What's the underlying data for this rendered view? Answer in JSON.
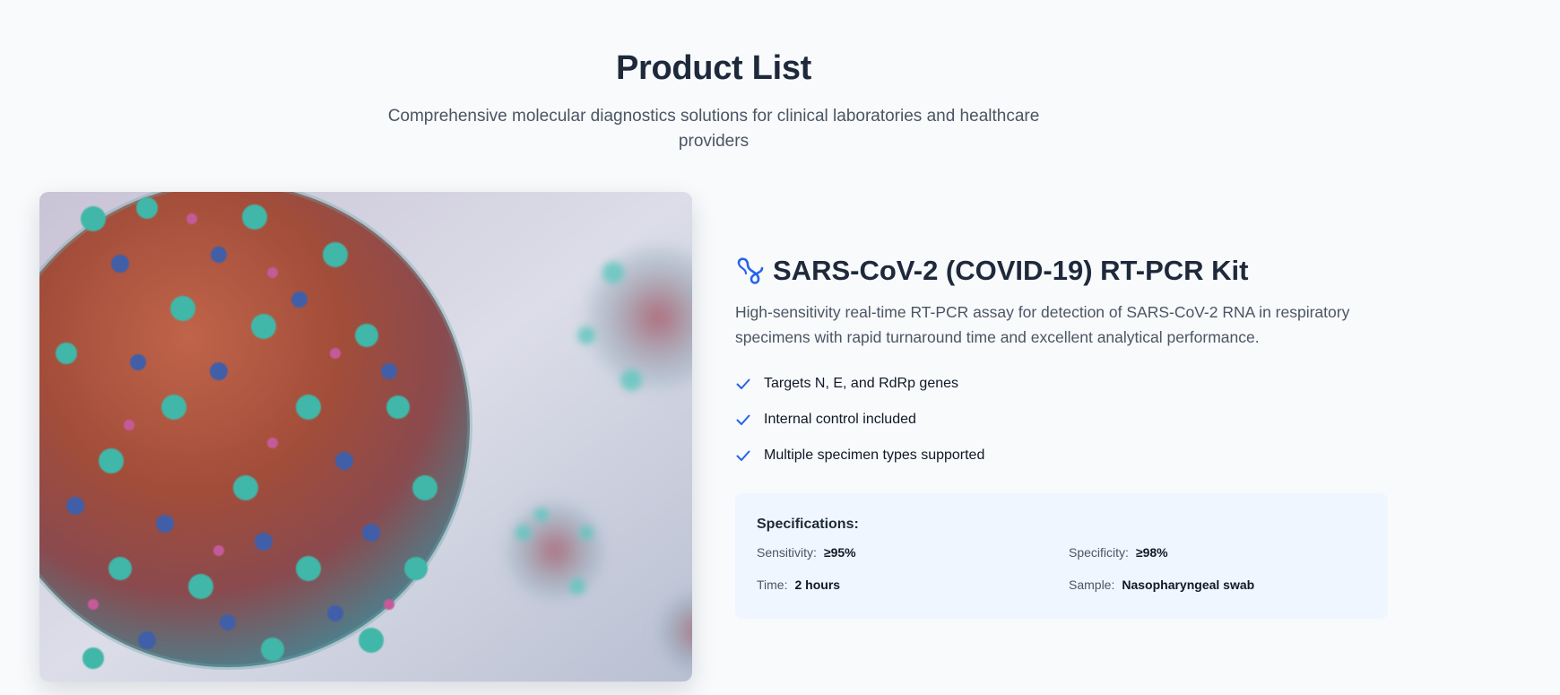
{
  "header": {
    "title": "Product List",
    "subtitle": "Comprehensive molecular diagnostics solutions for clinical laboratories and healthcare providers"
  },
  "product": {
    "image_icon": "coronavirus-image",
    "title_icon": "dna-icon",
    "name": "SARS-CoV-2 (COVID-19) RT-PCR Kit",
    "description": "High-sensitivity real-time RT-PCR assay for detection of SARS-CoV-2 RNA in respiratory specimens with rapid turnaround time and excellent analytical performance.",
    "features": [
      "Targets N, E, and RdRp genes",
      "Internal control included",
      "Multiple specimen types supported"
    ],
    "specs": {
      "title": "Specifications:",
      "items": [
        {
          "label": "Sensitivity:",
          "value": "≥95%"
        },
        {
          "label": "Specificity:",
          "value": "≥98%"
        },
        {
          "label": "Time:",
          "value": "2 hours"
        },
        {
          "label": "Sample:",
          "value": "Nasopharyngeal swab"
        }
      ]
    }
  },
  "colors": {
    "accent": "#2563eb",
    "background": "#f8fafc",
    "spec_panel": "#eff6ff",
    "heading": "#1e293b"
  }
}
